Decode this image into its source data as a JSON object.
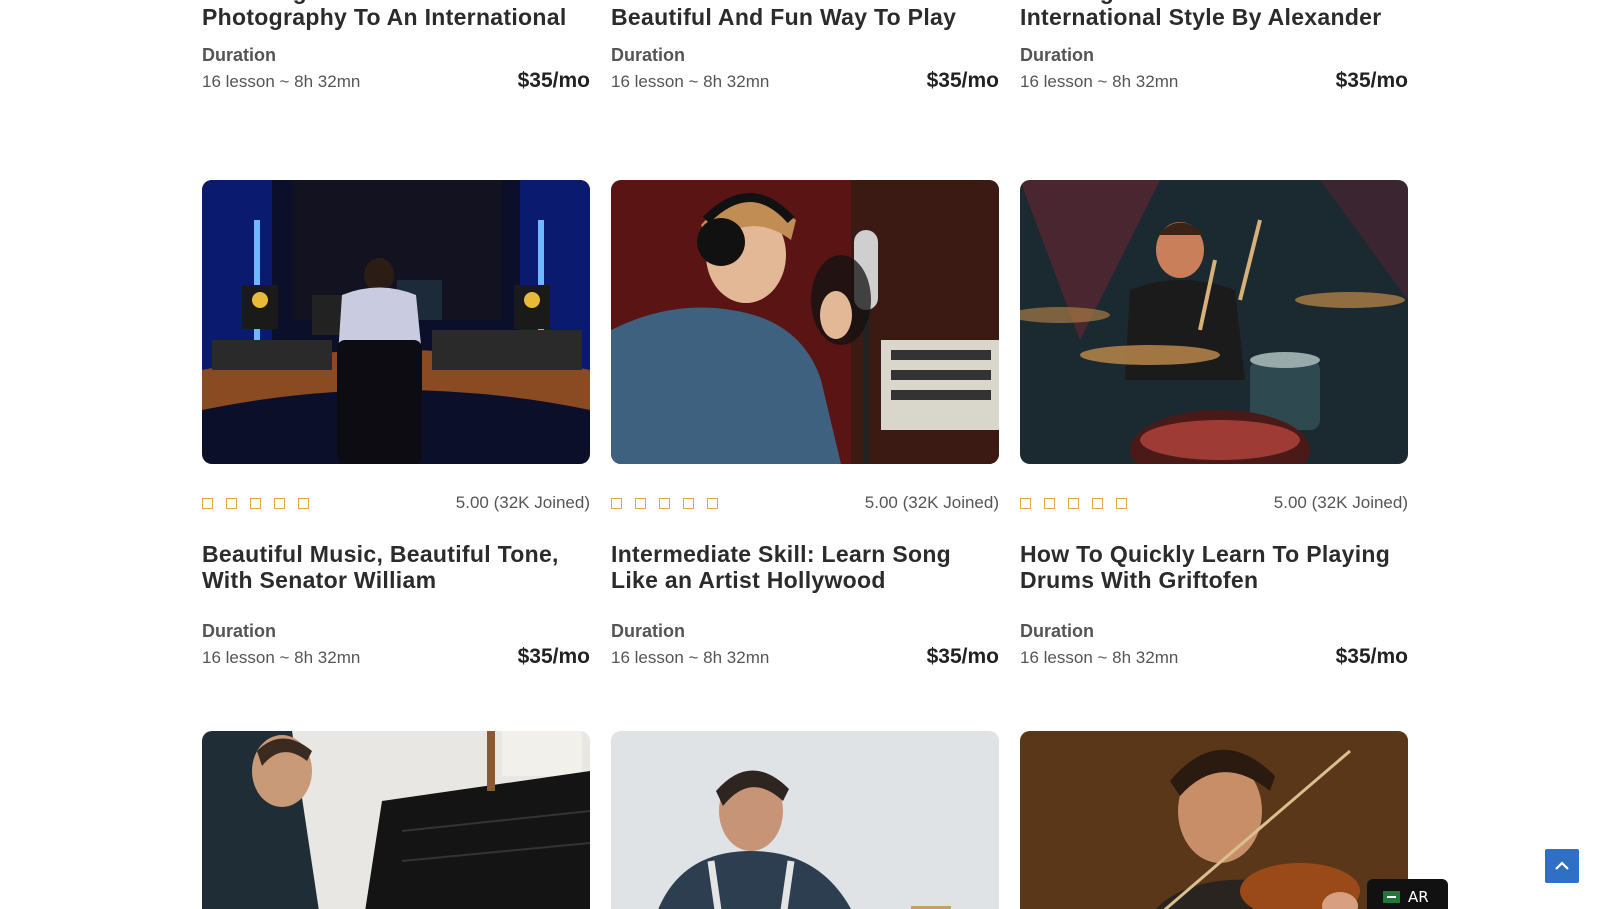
{
  "courses_top": [
    {
      "title": "Elevating The Art Of Street Photography To An International",
      "duration_label": "Duration",
      "duration": "16 lesson ~ 8h 32mn",
      "price": "$35/mo"
    },
    {
      "title": "Basketball Masters Share A Beautiful And Fun Way To Play",
      "duration_label": "Duration",
      "duration": "16 lesson ~ 8h 32mn",
      "price": "$35/mo"
    },
    {
      "title": "Cooking Local Flavors With International Style By Alexander",
      "duration_label": "Duration",
      "duration": "16 lesson ~ 8h 32mn",
      "price": "$35/mo"
    }
  ],
  "courses_mid": [
    {
      "image": "music-studio-producer",
      "rating": "5.00 (32K Joined)",
      "title": "Beautiful Music, Beautiful Tone, With Senator William",
      "duration_label": "Duration",
      "duration": "16 lesson ~ 8h 32mn",
      "price": "$35/mo"
    },
    {
      "image": "singer-with-headphones",
      "rating": "5.00 (32K Joined)",
      "title": "Intermediate Skill: Learn Song Like an Artist Hollywood",
      "duration_label": "Duration",
      "duration": "16 lesson ~ 8h 32mn",
      "price": "$35/mo"
    },
    {
      "image": "drummer-on-stage",
      "rating": "5.00 (32K Joined)",
      "title": "How To Quickly Learn To Playing Drums With Griftofen",
      "duration_label": "Duration",
      "duration": "16 lesson ~ 8h 32mn",
      "price": "$35/mo"
    }
  ],
  "courses_bottom": [
    {
      "image": "pianist-at-grand-piano"
    },
    {
      "image": "man-in-apron"
    },
    {
      "image": "violinist"
    }
  ],
  "scroll_top_icon": "chevron-up-icon",
  "language": {
    "flag": "saudi-flag-icon",
    "label": "AR"
  },
  "colors": {
    "star": "#e0a64b",
    "scroll_button": "#2f6fc4",
    "lang_bg": "#111111"
  }
}
